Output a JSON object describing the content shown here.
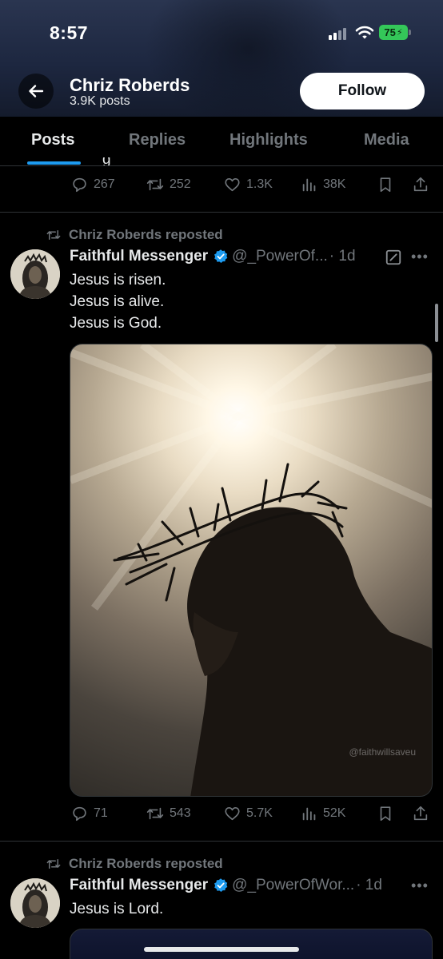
{
  "status_bar": {
    "time": "8:57",
    "battery": "75"
  },
  "header": {
    "name": "Chriz Roberds",
    "posts_count": "3.9K posts",
    "follow_label": "Follow"
  },
  "tabs": [
    {
      "label": "Posts",
      "active": true
    },
    {
      "label": "Replies",
      "active": false
    },
    {
      "label": "Highlights",
      "active": false
    },
    {
      "label": "Media",
      "active": false
    }
  ],
  "prev_post": {
    "cut_text": "g",
    "actions": {
      "replies": "267",
      "reposts": "252",
      "likes": "1.3K",
      "views": "38K"
    }
  },
  "posts": [
    {
      "repost_label": "Chriz Roberds reposted",
      "author": "Faithful Messenger",
      "handle": "@_PowerOf...",
      "time": "· 1d",
      "lines": [
        "Jesus is risen.",
        "Jesus is alive.",
        "Jesus is God."
      ],
      "media_watermark": "@faithwillsaveu",
      "actions": {
        "replies": "71",
        "reposts": "543",
        "likes": "5.7K",
        "views": "52K"
      }
    },
    {
      "repost_label": "Chriz Roberds reposted",
      "author": "Faithful Messenger",
      "handle": "@_PowerOfWor...",
      "time": "· 1d",
      "lines": [
        "Jesus is Lord."
      ]
    }
  ],
  "colors": {
    "accent": "#1d9bf0",
    "verified": "#1d9bf0",
    "battery": "#34c759",
    "muted": "#71767b",
    "text": "#e7e9ea"
  },
  "icons": [
    "back-arrow-icon",
    "signal-icon",
    "wifi-icon",
    "battery-icon",
    "reply-icon",
    "repost-icon",
    "like-icon",
    "views-icon",
    "bookmark-icon",
    "share-icon",
    "verified-badge-icon",
    "edit-icon",
    "more-icon"
  ]
}
